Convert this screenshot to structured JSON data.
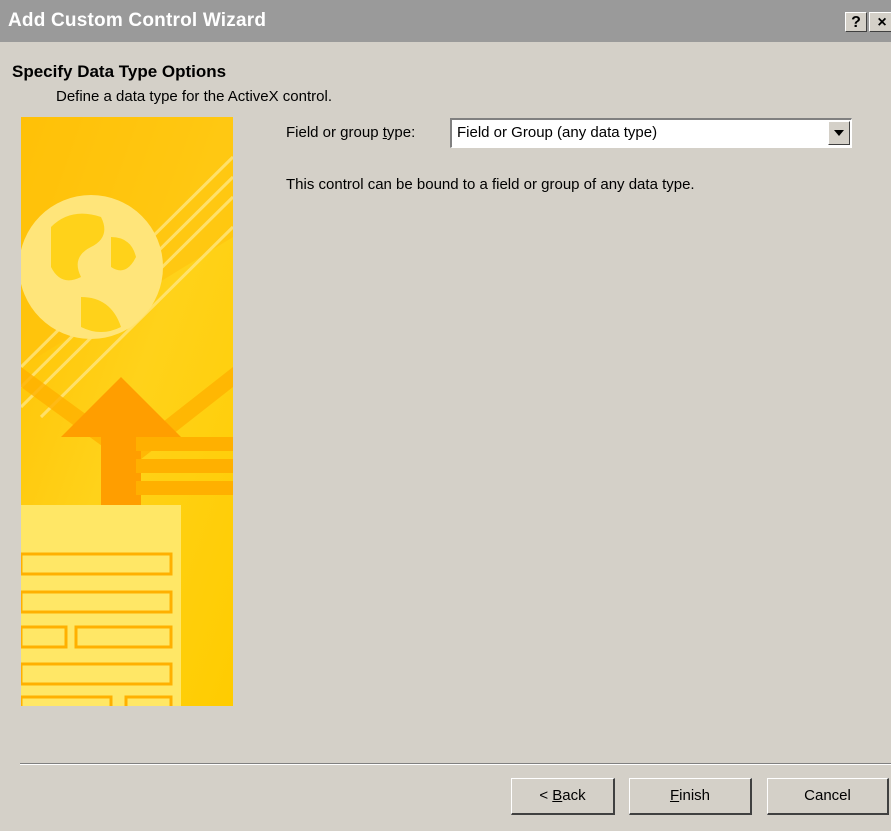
{
  "window": {
    "title": "Add Custom Control Wizard",
    "help_label": "?",
    "close_label": "×"
  },
  "header": {
    "title": "Specify Data Type Options",
    "subtitle": "Define a data type for the ActiveX control."
  },
  "field": {
    "label_pre": "Field or group ",
    "label_access": "t",
    "label_post": "ype:",
    "value": "Field or Group (any data type)"
  },
  "description": "This control can be bound to a field or group of any data type.",
  "buttons": {
    "back_pre": "< ",
    "back_access": "B",
    "back_post": "ack",
    "finish_access": "F",
    "finish_post": "inish",
    "cancel": "Cancel"
  },
  "colors": {
    "banner_yellow": "#ffd21a",
    "banner_orange": "#ffb000",
    "title_bar": "#9a9a9a",
    "dialog_face": "#d4d0c8"
  },
  "icons": [
    "help-icon",
    "close-icon",
    "dropdown-arrow-icon",
    "globe-icon",
    "arrow-up-icon"
  ]
}
